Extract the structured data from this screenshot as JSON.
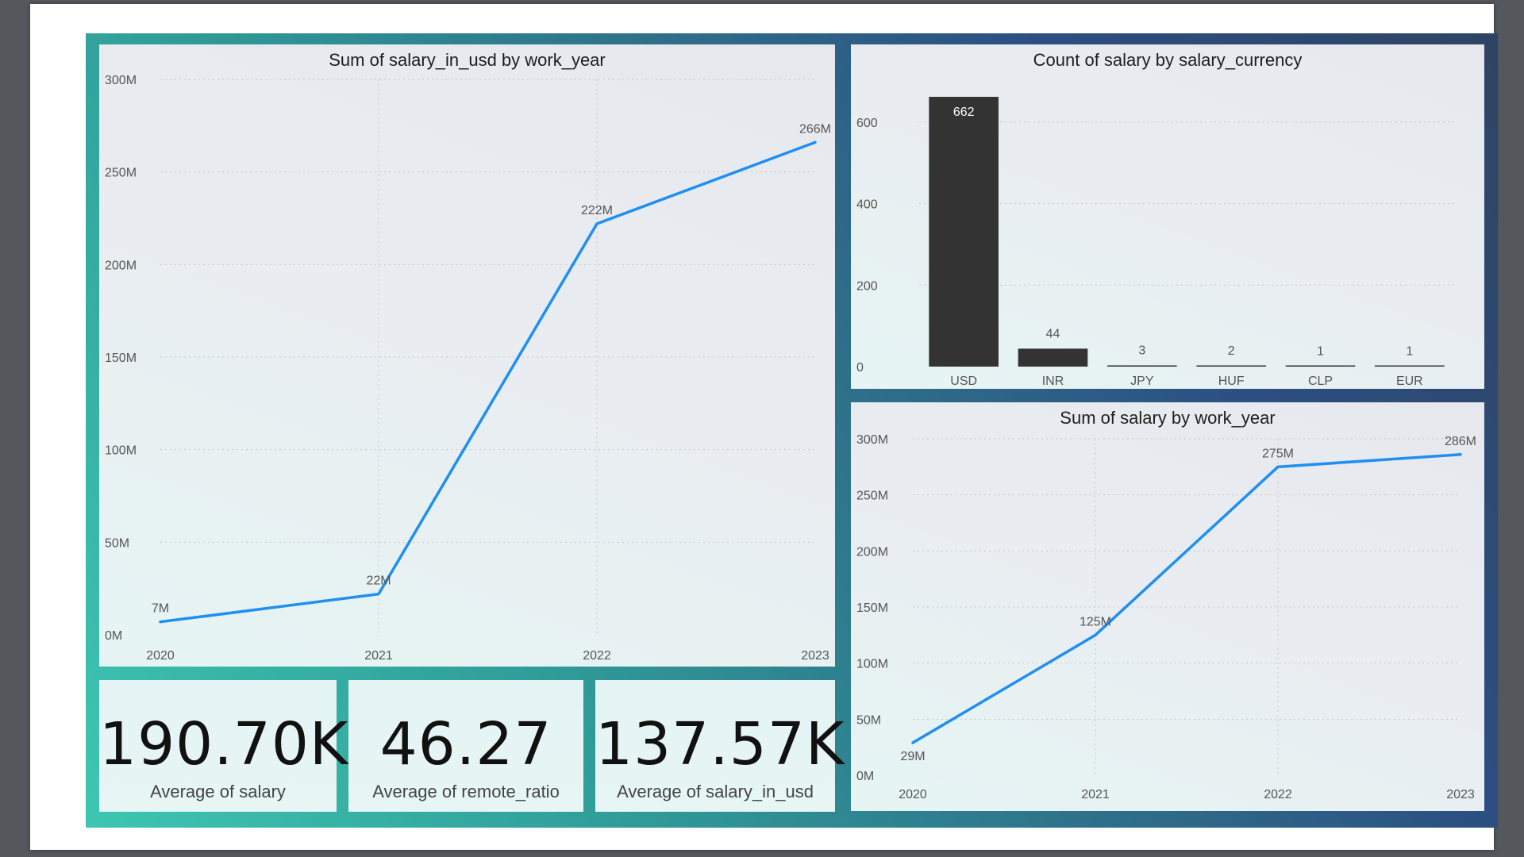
{
  "colors": {
    "line": "#1f8ff0",
    "bar": "#333333",
    "grid": "#c8c8c8"
  },
  "chart_data": [
    {
      "id": "usd_by_year",
      "type": "line",
      "title": "Sum of salary_in_usd by work_year",
      "x": [
        "2020",
        "2021",
        "2022",
        "2023"
      ],
      "values": [
        7,
        22,
        222,
        266
      ],
      "value_labels": [
        "7M",
        "22M",
        "222M",
        "266M"
      ],
      "yticks": [
        0,
        50,
        100,
        150,
        200,
        250,
        300
      ],
      "ytick_labels": [
        "0M",
        "50M",
        "100M",
        "150M",
        "200M",
        "250M",
        "300M"
      ],
      "ylim": [
        0,
        300
      ],
      "unit": "M",
      "grid": true
    },
    {
      "id": "count_by_currency",
      "type": "bar",
      "title": "Count of salary by salary_currency",
      "categories": [
        "USD",
        "INR",
        "JPY",
        "HUF",
        "CLP",
        "EUR"
      ],
      "values": [
        662,
        44,
        3,
        2,
        1,
        1
      ],
      "value_labels": [
        "662",
        "44",
        "3",
        "2",
        "1",
        "1"
      ],
      "yticks": [
        0,
        200,
        400,
        600
      ],
      "ytick_labels": [
        "0",
        "200",
        "400",
        "600"
      ],
      "ylim": [
        0,
        662
      ],
      "grid": true
    },
    {
      "id": "salary_by_year",
      "type": "line",
      "title": "Sum of salary by work_year",
      "x": [
        "2020",
        "2021",
        "2022",
        "2023"
      ],
      "values": [
        29,
        125,
        275,
        286
      ],
      "value_labels": [
        "29M",
        "125M",
        "275M",
        "286M"
      ],
      "yticks": [
        0,
        50,
        100,
        150,
        200,
        250,
        300
      ],
      "ytick_labels": [
        "0M",
        "50M",
        "100M",
        "150M",
        "200M",
        "250M",
        "300M"
      ],
      "ylim": [
        0,
        300
      ],
      "unit": "M",
      "grid": true
    }
  ],
  "kpis": [
    {
      "value": "190.70K",
      "label": "Average of salary"
    },
    {
      "value": "46.27",
      "label": "Average of remote_ratio"
    },
    {
      "value": "137.57K",
      "label": "Average of salary_in_usd"
    }
  ]
}
